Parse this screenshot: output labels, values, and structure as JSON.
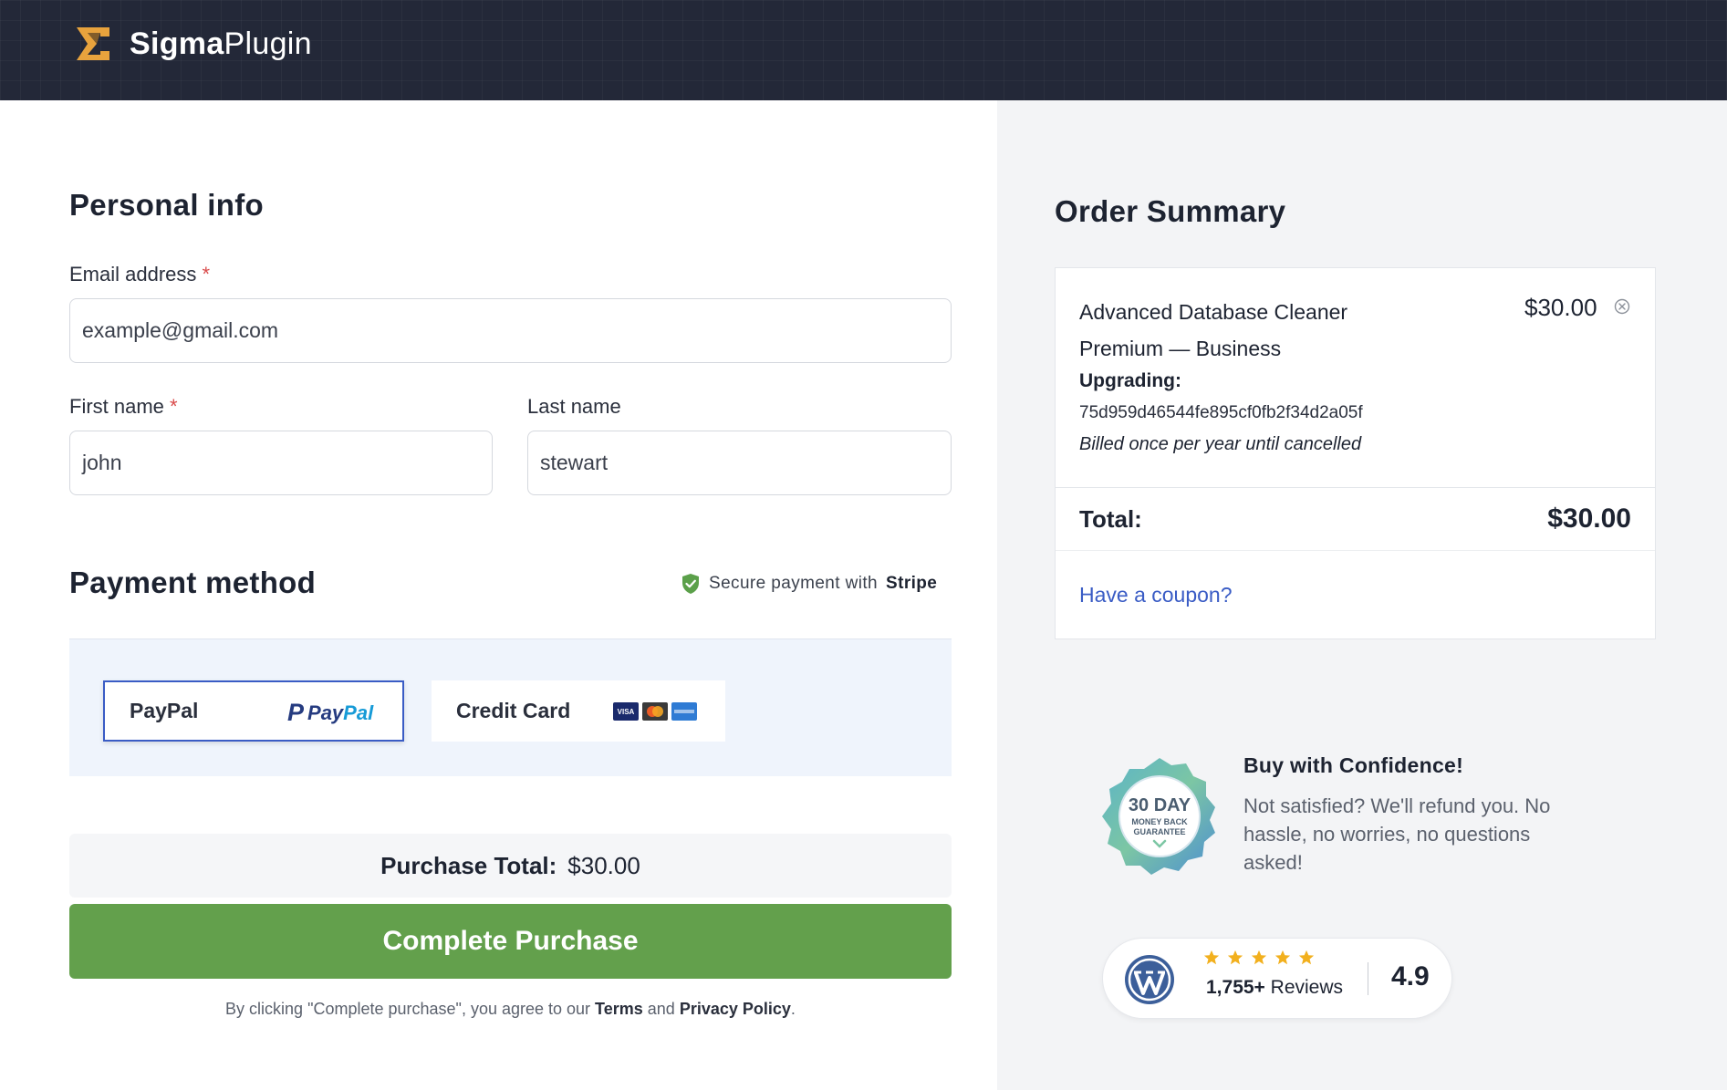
{
  "header": {
    "brand_bold": "Sigma",
    "brand_light": "Plugin"
  },
  "personal": {
    "title": "Personal info",
    "email_label": "Email address",
    "email_value": "example@gmail.com",
    "first_label": "First name",
    "first_value": "john",
    "last_label": "Last name",
    "last_value": "stewart",
    "required_mark": "*"
  },
  "payment": {
    "title": "Payment method",
    "secure_text": "Secure payment with",
    "secure_brand": "Stripe",
    "options": [
      {
        "label": "PayPal",
        "logo_p": "P",
        "logo_text_a": "Pay",
        "logo_text_b": "Pal",
        "selected": true
      },
      {
        "label": "Credit Card",
        "card_visa": "VISA",
        "selected": false
      }
    ]
  },
  "purchase": {
    "total_label": "Purchase Total:",
    "total_value": "$30.00",
    "button_label": "Complete Purchase",
    "legal_prefix": "By clicking \"Complete purchase\", you agree to our",
    "terms": "Terms",
    "and": "and",
    "privacy": "Privacy Policy",
    "period": "."
  },
  "order": {
    "title": "Order Summary",
    "item_name": "Advanced Database Cleaner Premium — Business",
    "item_price": "$30.00",
    "upgrading_label": "Upgrading:",
    "upgrading_id": "75d959d46544fe895cf0fb2f34d2a05f",
    "billing": "Billed once per year until cancelled",
    "total_label": "Total:",
    "total_value": "$30.00",
    "coupon": "Have a coupon?"
  },
  "confidence": {
    "badge_line1": "30 DAY",
    "badge_line2": "MONEY BACK",
    "badge_line3": "GUARANTEE",
    "title": "Buy with Confidence!",
    "text": "Not satisfied? We'll refund you. No hassle, no worries, no questions asked!"
  },
  "reviews": {
    "count": "1,755+",
    "count_label": "Reviews",
    "rating": "4.9",
    "stars": 5
  },
  "colors": {
    "header_bg": "#232838",
    "accent_orange": "#e8a33d",
    "button_green": "#63a04c",
    "link_blue": "#3a5cc5",
    "star_yellow": "#f2b01e"
  }
}
